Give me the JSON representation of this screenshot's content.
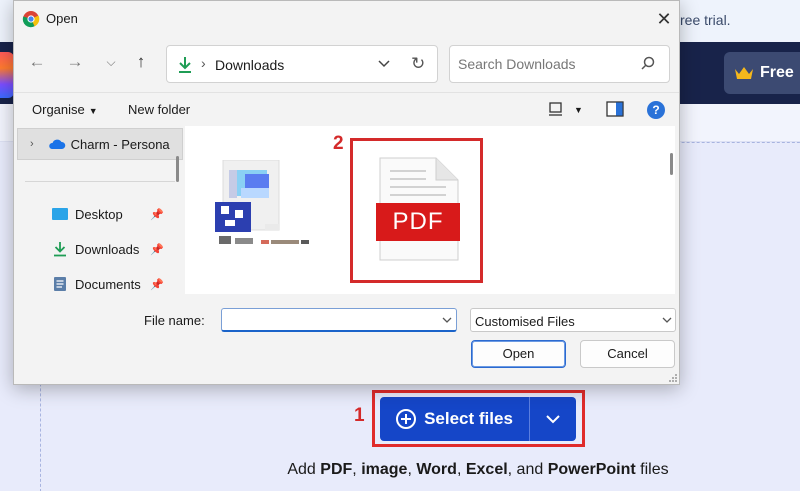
{
  "background": {
    "trial_text": "ree trial.",
    "free_button_label": "Free",
    "select_files_label": "Select files",
    "add_files_text": {
      "prefix": "Add",
      "pdf": "PDF",
      "sep1": ",",
      "image": "image",
      "sep2": ",",
      "word": "Word",
      "sep3": ",",
      "excel": "Excel",
      "and": ", and",
      "powerpoint": "PowerPoint",
      "suffix": "files"
    }
  },
  "annotations": {
    "step1": "1",
    "step2": "2"
  },
  "dialog": {
    "title": "Open",
    "address": {
      "path": "Downloads"
    },
    "search": {
      "placeholder": "Search Downloads"
    },
    "toolbar": {
      "organise": "Organise",
      "new_folder": "New folder"
    },
    "sidebar": [
      {
        "label": "Charm - Persona",
        "icon": "cloud-icon"
      },
      {
        "label": "Desktop",
        "icon": "desktop-icon",
        "pinned": true
      },
      {
        "label": "Downloads",
        "icon": "download-icon",
        "pinned": true
      },
      {
        "label": "Documents",
        "icon": "documents-icon",
        "pinned": true
      }
    ],
    "files": [
      {
        "name": "",
        "type": "pixelated-image"
      },
      {
        "name": "",
        "type": "pdf",
        "icon_text": "PDF"
      }
    ],
    "filename_label": "File name:",
    "filename_value": "",
    "filetype_value": "Customised Files",
    "open_button": "Open",
    "cancel_button": "Cancel"
  },
  "colors": {
    "brand_blue": "#1546c8",
    "header_navy": "#18234a",
    "highlight_red": "#d42a2a",
    "pdf_red": "#d81a1a"
  }
}
